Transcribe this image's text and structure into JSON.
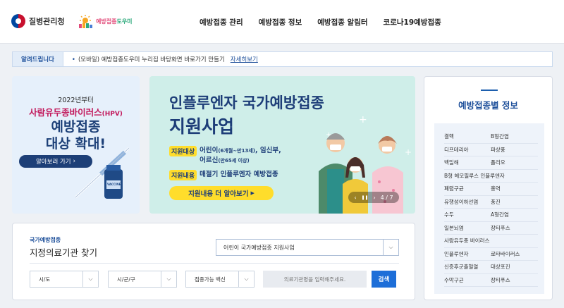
{
  "header": {
    "kdca_logo": "질병관리청",
    "helper_logo_prefix": "예방접종",
    "helper_logo_suffix": "도우미",
    "nav": [
      "예방접종 관리",
      "예방접종 정보",
      "예방접종 알림터",
      "코로나19예방접종"
    ]
  },
  "notice": {
    "tag": "알려드립니다",
    "bullet": "•",
    "text": "(모바일) 예방접종도우미 누리집 바탕화면 바로가기 만들기",
    "more": "자세히보기"
  },
  "hpv_card": {
    "year": "2022년부터",
    "subject": "사람유두종바이러스",
    "subject_abbr": "(HPV)",
    "line1": "예방접종",
    "line2": "대상 확대!",
    "button": "알아보러 가기",
    "vial_label": "VACCINE",
    "pager_prev": "‹",
    "pager_pause": "❚❚",
    "pager_next": "›"
  },
  "banner": {
    "title1": "인플루엔자 국가예방접종",
    "title2": "지원사업",
    "target_label": "지원대상",
    "target_a": "어린이",
    "target_a_note": "(6개월~만13세)",
    "target_b": ", 임신부,",
    "target_c": "어르신",
    "target_c_note": "(만65세 이상)",
    "content_label": "지원내용",
    "content_text": "매절기 인플루엔자 예방접종",
    "cta": "지원내용 더 알아보기",
    "cta_arrow": "▶",
    "pager_prev": "‹",
    "pager_pause": "❚❚",
    "pager_next": "›",
    "pager_count": "4 / 7"
  },
  "side": {
    "title": "예방접종별 정보",
    "items": [
      "결핵",
      "B형간염",
      "디프테리아",
      "파상풍",
      "백일해",
      "폴리오",
      "B형 헤모필루스 인플루엔자",
      "",
      "폐렴구균",
      "홍역",
      "유행성이하선염",
      "풍진",
      "수두",
      "A형간염",
      "일본뇌염",
      "장티푸스",
      "사람유두종 바이러스",
      "",
      "인플루엔자",
      "로타바이러스",
      "신증후군출혈열",
      "대상포진",
      "수막구균",
      "장티푸스"
    ]
  },
  "search": {
    "sub": "국가예방접종",
    "title": "지정의료기관 찾기",
    "program": "어린이 국가예방접종 지원사업",
    "sido": "시/도",
    "sigungu": "시/군/구",
    "vaccine": "접종가능 백신",
    "placeholder": "의료기관명을 입력해주세요.",
    "button": "검색",
    "chevron": "⌵"
  },
  "colors": {
    "brand_navy": "#1d3d78",
    "accent_blue": "#1d6ed8",
    "highlight_yellow": "#ffdd2b",
    "banner_bg": "#cfeee9",
    "hpv_pink": "#c2185b"
  }
}
